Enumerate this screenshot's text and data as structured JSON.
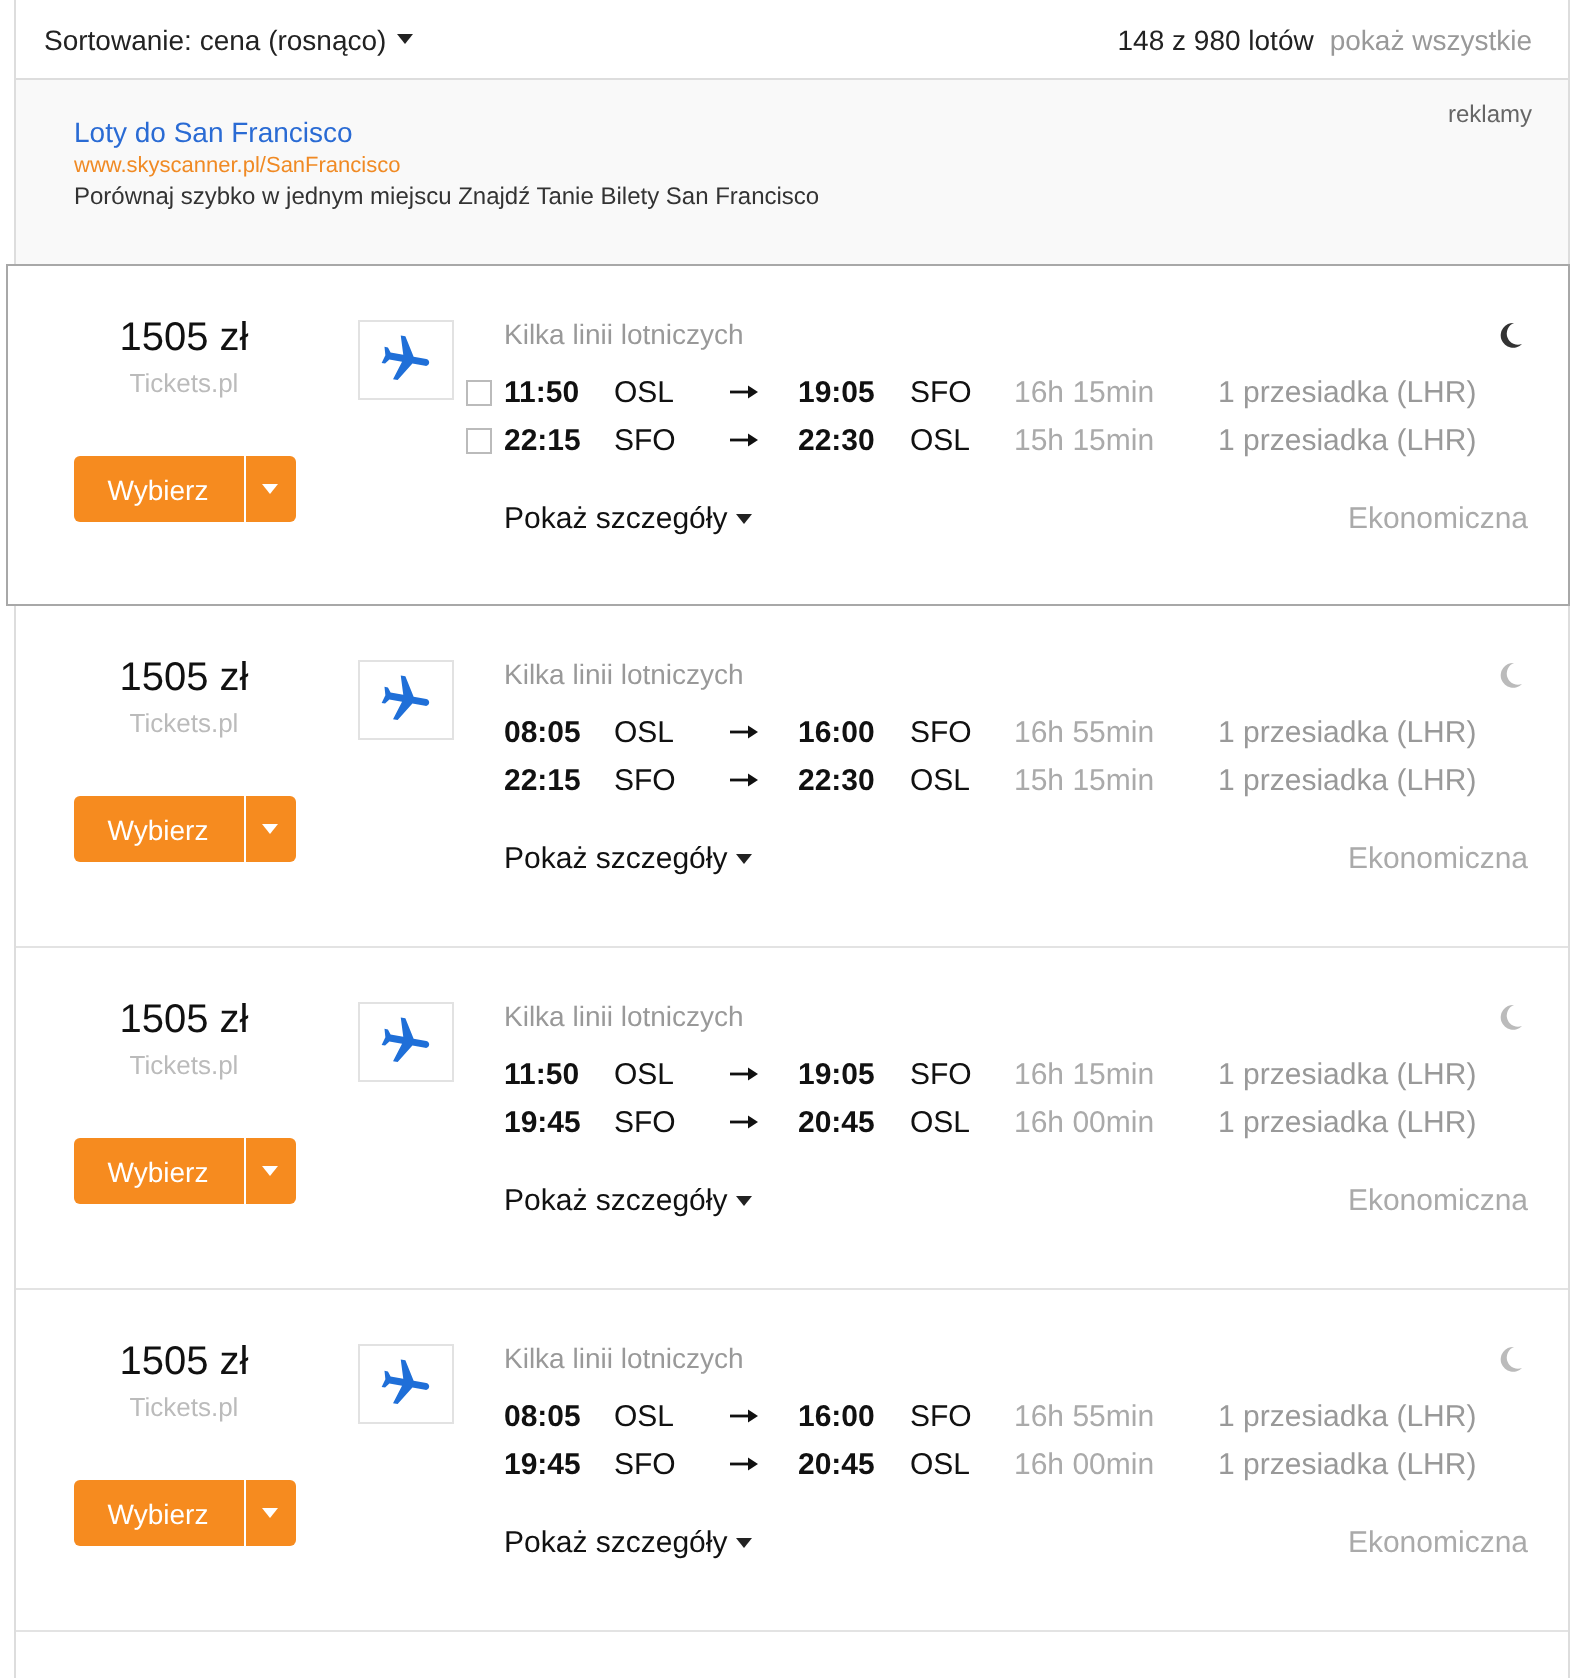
{
  "sort": {
    "label": "Sortowanie: cena (rosnąco)"
  },
  "results": {
    "count": "148 z 980 lotów",
    "show_all": "pokaż wszystkie"
  },
  "ad": {
    "title": "Loty do San Francisco",
    "url": "www.skyscanner.pl/SanFrancisco",
    "description": "Porównaj szybko w jednym miejscu Znajdź Tanie Bilety San Francisco",
    "label": "reklamy"
  },
  "flights": [
    {
      "highlighted": true,
      "price": "1505 zł",
      "provider": "Tickets.pl",
      "select_button": "Wybierz",
      "airline": "Kilka linii lotniczych",
      "legs": [
        {
          "checked": false,
          "depart_time": "11:50",
          "from": "OSL",
          "arrive_time": "19:05",
          "to": "SFO",
          "duration": "16h 15min",
          "stops": "1 przesiadka (LHR)"
        },
        {
          "checked": false,
          "depart_time": "22:15",
          "from": "SFO",
          "arrive_time": "22:30",
          "to": "OSL",
          "duration": "15h 15min",
          "stops": "1 przesiadka (LHR)"
        }
      ],
      "details_link": "Pokaż szczegóły",
      "cabin_class": "Ekonomiczna"
    },
    {
      "highlighted": false,
      "price": "1505 zł",
      "provider": "Tickets.pl",
      "select_button": "Wybierz",
      "airline": "Kilka linii lotniczych",
      "legs": [
        {
          "depart_time": "08:05",
          "from": "OSL",
          "arrive_time": "16:00",
          "to": "SFO",
          "duration": "16h 55min",
          "stops": "1 przesiadka (LHR)"
        },
        {
          "depart_time": "22:15",
          "from": "SFO",
          "arrive_time": "22:30",
          "to": "OSL",
          "duration": "15h 15min",
          "stops": "1 przesiadka (LHR)"
        }
      ],
      "details_link": "Pokaż szczegóły",
      "cabin_class": "Ekonomiczna"
    },
    {
      "highlighted": false,
      "price": "1505 zł",
      "provider": "Tickets.pl",
      "select_button": "Wybierz",
      "airline": "Kilka linii lotniczych",
      "legs": [
        {
          "depart_time": "11:50",
          "from": "OSL",
          "arrive_time": "19:05",
          "to": "SFO",
          "duration": "16h 15min",
          "stops": "1 przesiadka (LHR)"
        },
        {
          "depart_time": "19:45",
          "from": "SFO",
          "arrive_time": "20:45",
          "to": "OSL",
          "duration": "16h 00min",
          "stops": "1 przesiadka (LHR)"
        }
      ],
      "details_link": "Pokaż szczegóły",
      "cabin_class": "Ekonomiczna"
    },
    {
      "highlighted": false,
      "price": "1505 zł",
      "provider": "Tickets.pl",
      "select_button": "Wybierz",
      "airline": "Kilka linii lotniczych",
      "legs": [
        {
          "depart_time": "08:05",
          "from": "OSL",
          "arrive_time": "16:00",
          "to": "SFO",
          "duration": "16h 55min",
          "stops": "1 przesiadka (LHR)"
        },
        {
          "depart_time": "19:45",
          "from": "SFO",
          "arrive_time": "20:45",
          "to": "OSL",
          "duration": "16h 00min",
          "stops": "1 przesiadka (LHR)"
        }
      ],
      "details_link": "Pokaż szczegóły",
      "cabin_class": "Ekonomiczna"
    }
  ]
}
